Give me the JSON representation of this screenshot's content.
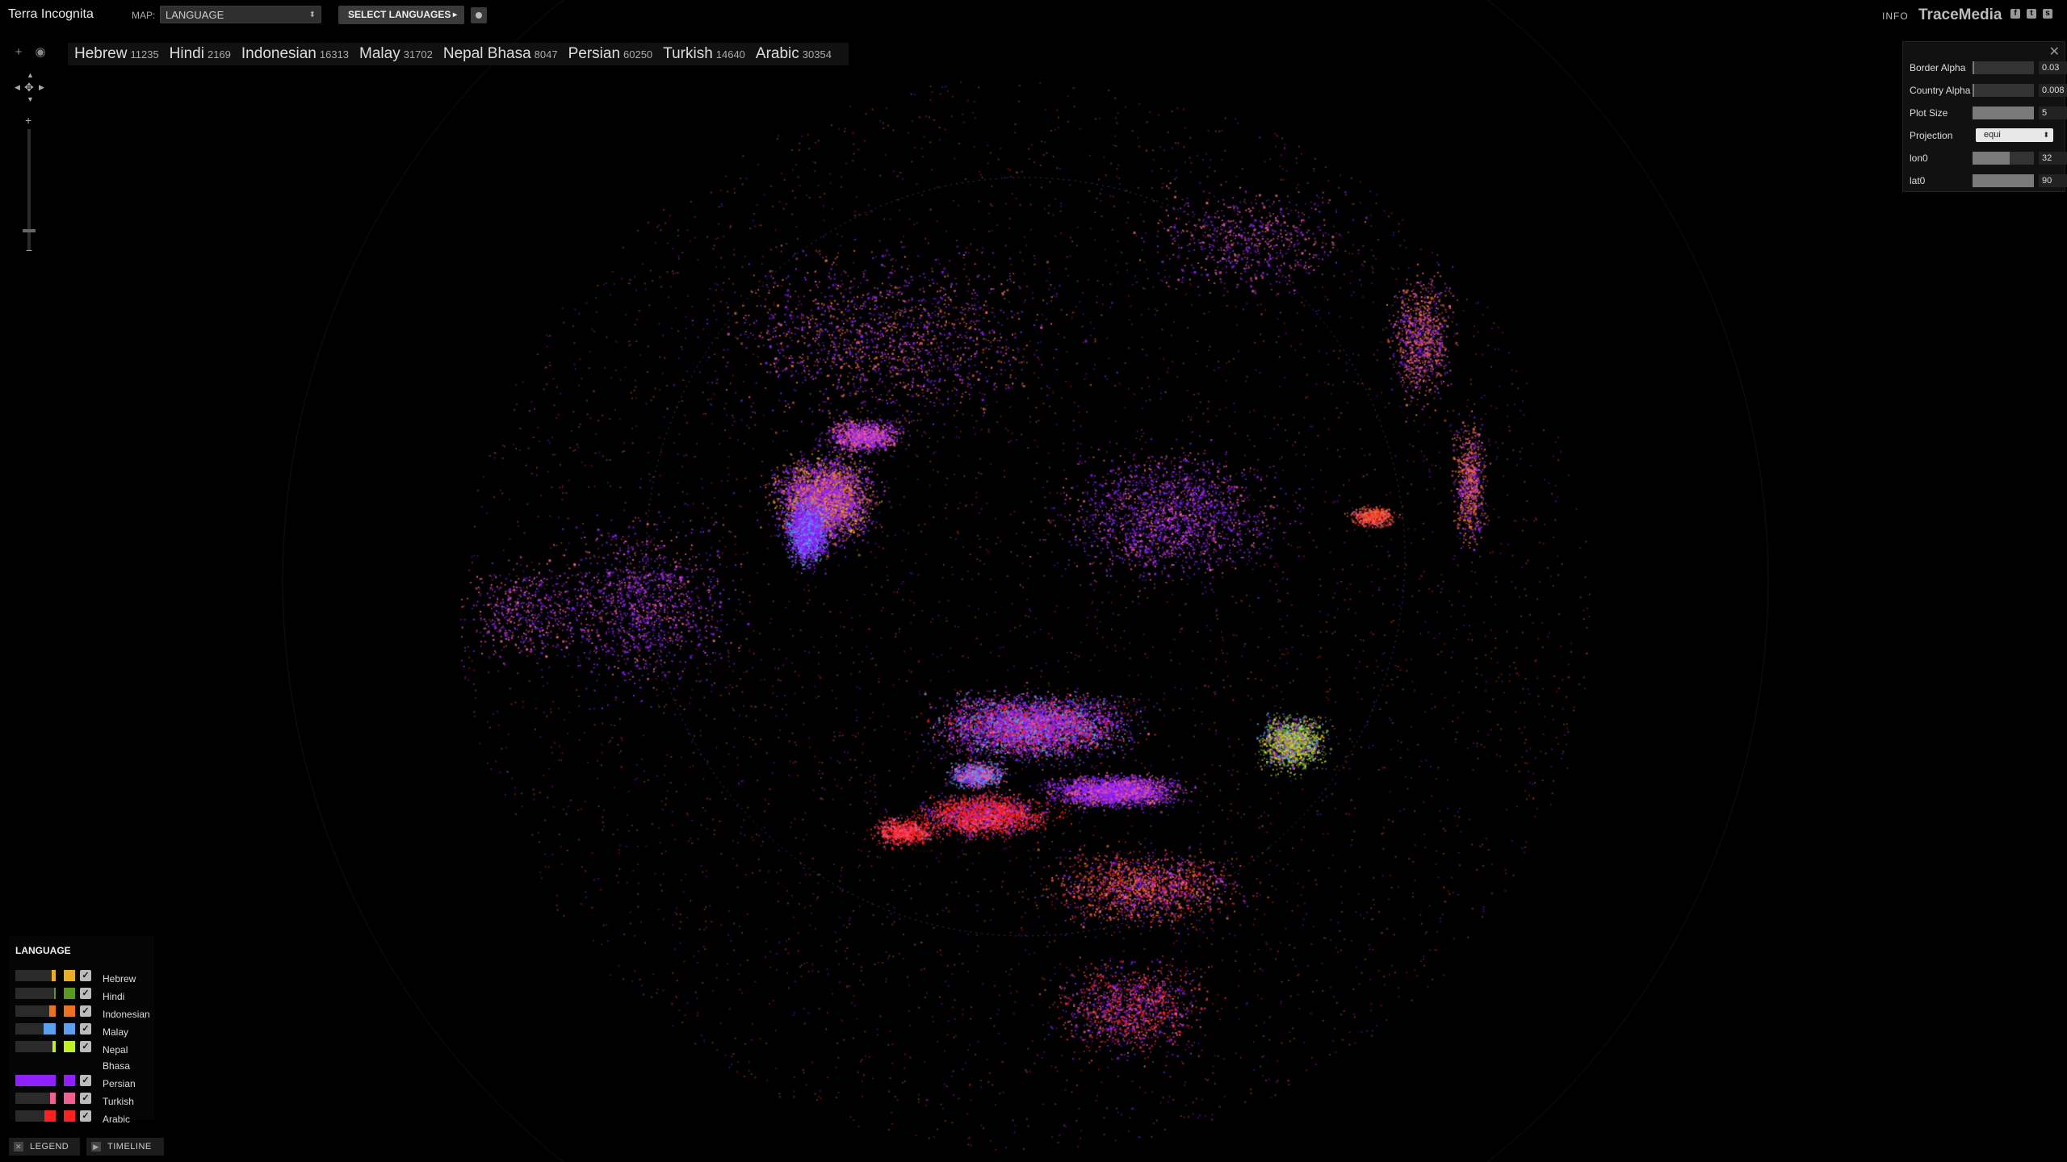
{
  "header": {
    "app_title": "Terra Incognita",
    "map_label": "MAP:",
    "map_select_value": "LANGUAGE",
    "select_button": "SELECT LANGUAGES",
    "info_link": "INFO",
    "brand": "TraceMedia"
  },
  "languages": [
    {
      "name": "Hebrew",
      "count": "11235",
      "color": "#e8b020",
      "share": 0.1
    },
    {
      "name": "Hindi",
      "count": "2169",
      "color": "#5a9a20",
      "share": 0.03
    },
    {
      "name": "Indonesian",
      "count": "16313",
      "color": "#f07020",
      "share": 0.15
    },
    {
      "name": "Malay",
      "count": "31702",
      "color": "#5aa0f0",
      "share": 0.3
    },
    {
      "name": "Nepal Bhasa",
      "count": "8047",
      "color": "#c0f020",
      "share": 0.08
    },
    {
      "name": "Persian",
      "count": "60250",
      "color": "#9020ff",
      "share": 1.0
    },
    {
      "name": "Turkish",
      "count": "14640",
      "color": "#f06090",
      "share": 0.14
    },
    {
      "name": "Arabic",
      "count": "30354",
      "color": "#ff2020",
      "share": 0.29
    }
  ],
  "settings": {
    "border_alpha": {
      "label": "Border Alpha",
      "value": "0.03",
      "level": 0.03
    },
    "country_alpha": {
      "label": "Country Alpha",
      "value": "0.008",
      "level": 0.01
    },
    "plot_size": {
      "label": "Plot Size",
      "value": "5",
      "level": 1.0
    },
    "projection": {
      "label": "Projection",
      "value": "equi"
    },
    "lon0": {
      "label": "lon0",
      "value": "32",
      "level": 0.6
    },
    "lat0": {
      "label": "lat0",
      "value": "90",
      "level": 1.0
    }
  },
  "legend": {
    "title": "LANGUAGE",
    "button": "LEGEND"
  },
  "timeline": {
    "button": "TIMELINE"
  },
  "icons": {
    "add": "plus-icon",
    "view": "eye-icon",
    "pan": "pan-arrows-icon",
    "close": "close-icon",
    "facebook": "facebook-icon",
    "twitter": "twitter-icon",
    "share": "share-icon",
    "play": "play-icon"
  }
}
